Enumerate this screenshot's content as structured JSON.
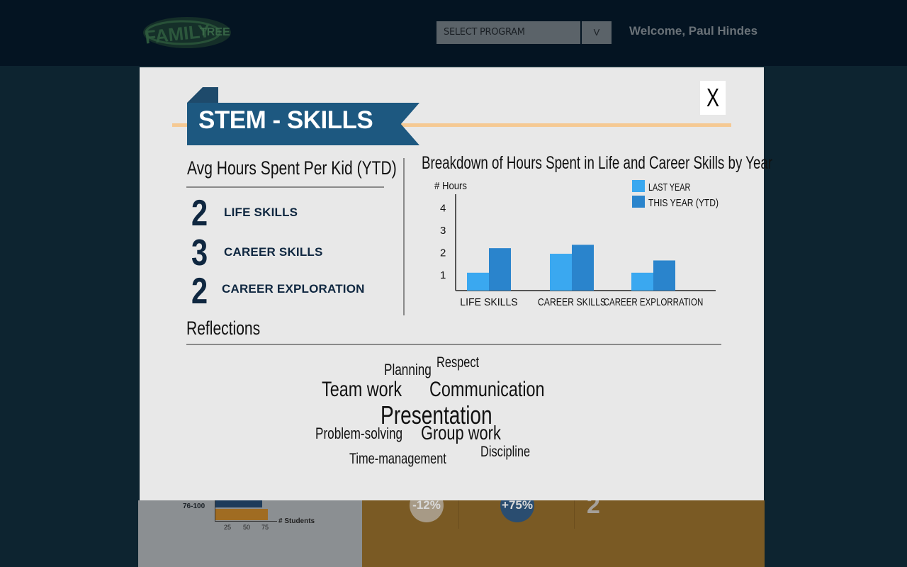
{
  "header": {
    "logo_text": "FAMILY TREE",
    "program_select_value": "SELECT PROGRAM",
    "program_select_button": "V",
    "welcome": "Welcome, Paul Hindes"
  },
  "background": {
    "row_label": "76-100",
    "ticks": [
      "25",
      "50",
      "75"
    ],
    "students_label": "# Students",
    "metric_1": "-12%",
    "metric_2": "+75%",
    "metric_3": "2"
  },
  "modal": {
    "close_label": "X",
    "title": "STEM - SKILLS",
    "avg_heading": "Avg Hours Spent Per Kid (YTD)",
    "stats": [
      {
        "value": "2",
        "label": "LIFE SKILLS"
      },
      {
        "value": "3",
        "label": "CAREER SKILLS"
      },
      {
        "value": "2",
        "label": "CAREER EXPLORATION"
      }
    ],
    "chart_title": "Breakdown of Hours Spent in Life and Career Skills by Year",
    "reflections_heading": "Reflections",
    "reflection_words": [
      {
        "text": "Planning",
        "size": 22
      },
      {
        "text": "Respect",
        "size": 21
      },
      {
        "text": "Team work",
        "size": 30
      },
      {
        "text": "Communication",
        "size": 30
      },
      {
        "text": "Presentation",
        "size": 36
      },
      {
        "text": "Problem-solving",
        "size": 22
      },
      {
        "text": "Group work",
        "size": 28
      },
      {
        "text": "Discipline",
        "size": 21
      },
      {
        "text": "Time-management",
        "size": 21
      }
    ]
  },
  "chart_data": {
    "type": "bar",
    "title": "Breakdown of Hours Spent in Life and Career Skills by Year",
    "ylabel": "# Hours",
    "xlabel": "",
    "categories": [
      "LIFE SKILLS",
      "CAREER SKILLS",
      "CAREER EXPLORRATION"
    ],
    "series": [
      {
        "name": "LAST YEAR",
        "color": "#3aa8f0",
        "values": [
          0.8,
          1.65,
          0.8
        ]
      },
      {
        "name": "THIS YEAR (YTD)",
        "color": "#2a84cc",
        "values": [
          1.9,
          2.05,
          1.35
        ]
      }
    ],
    "yticks": [
      1,
      2,
      3,
      4
    ],
    "ylim": [
      0,
      4.4
    ],
    "legend_position": "top-right"
  }
}
